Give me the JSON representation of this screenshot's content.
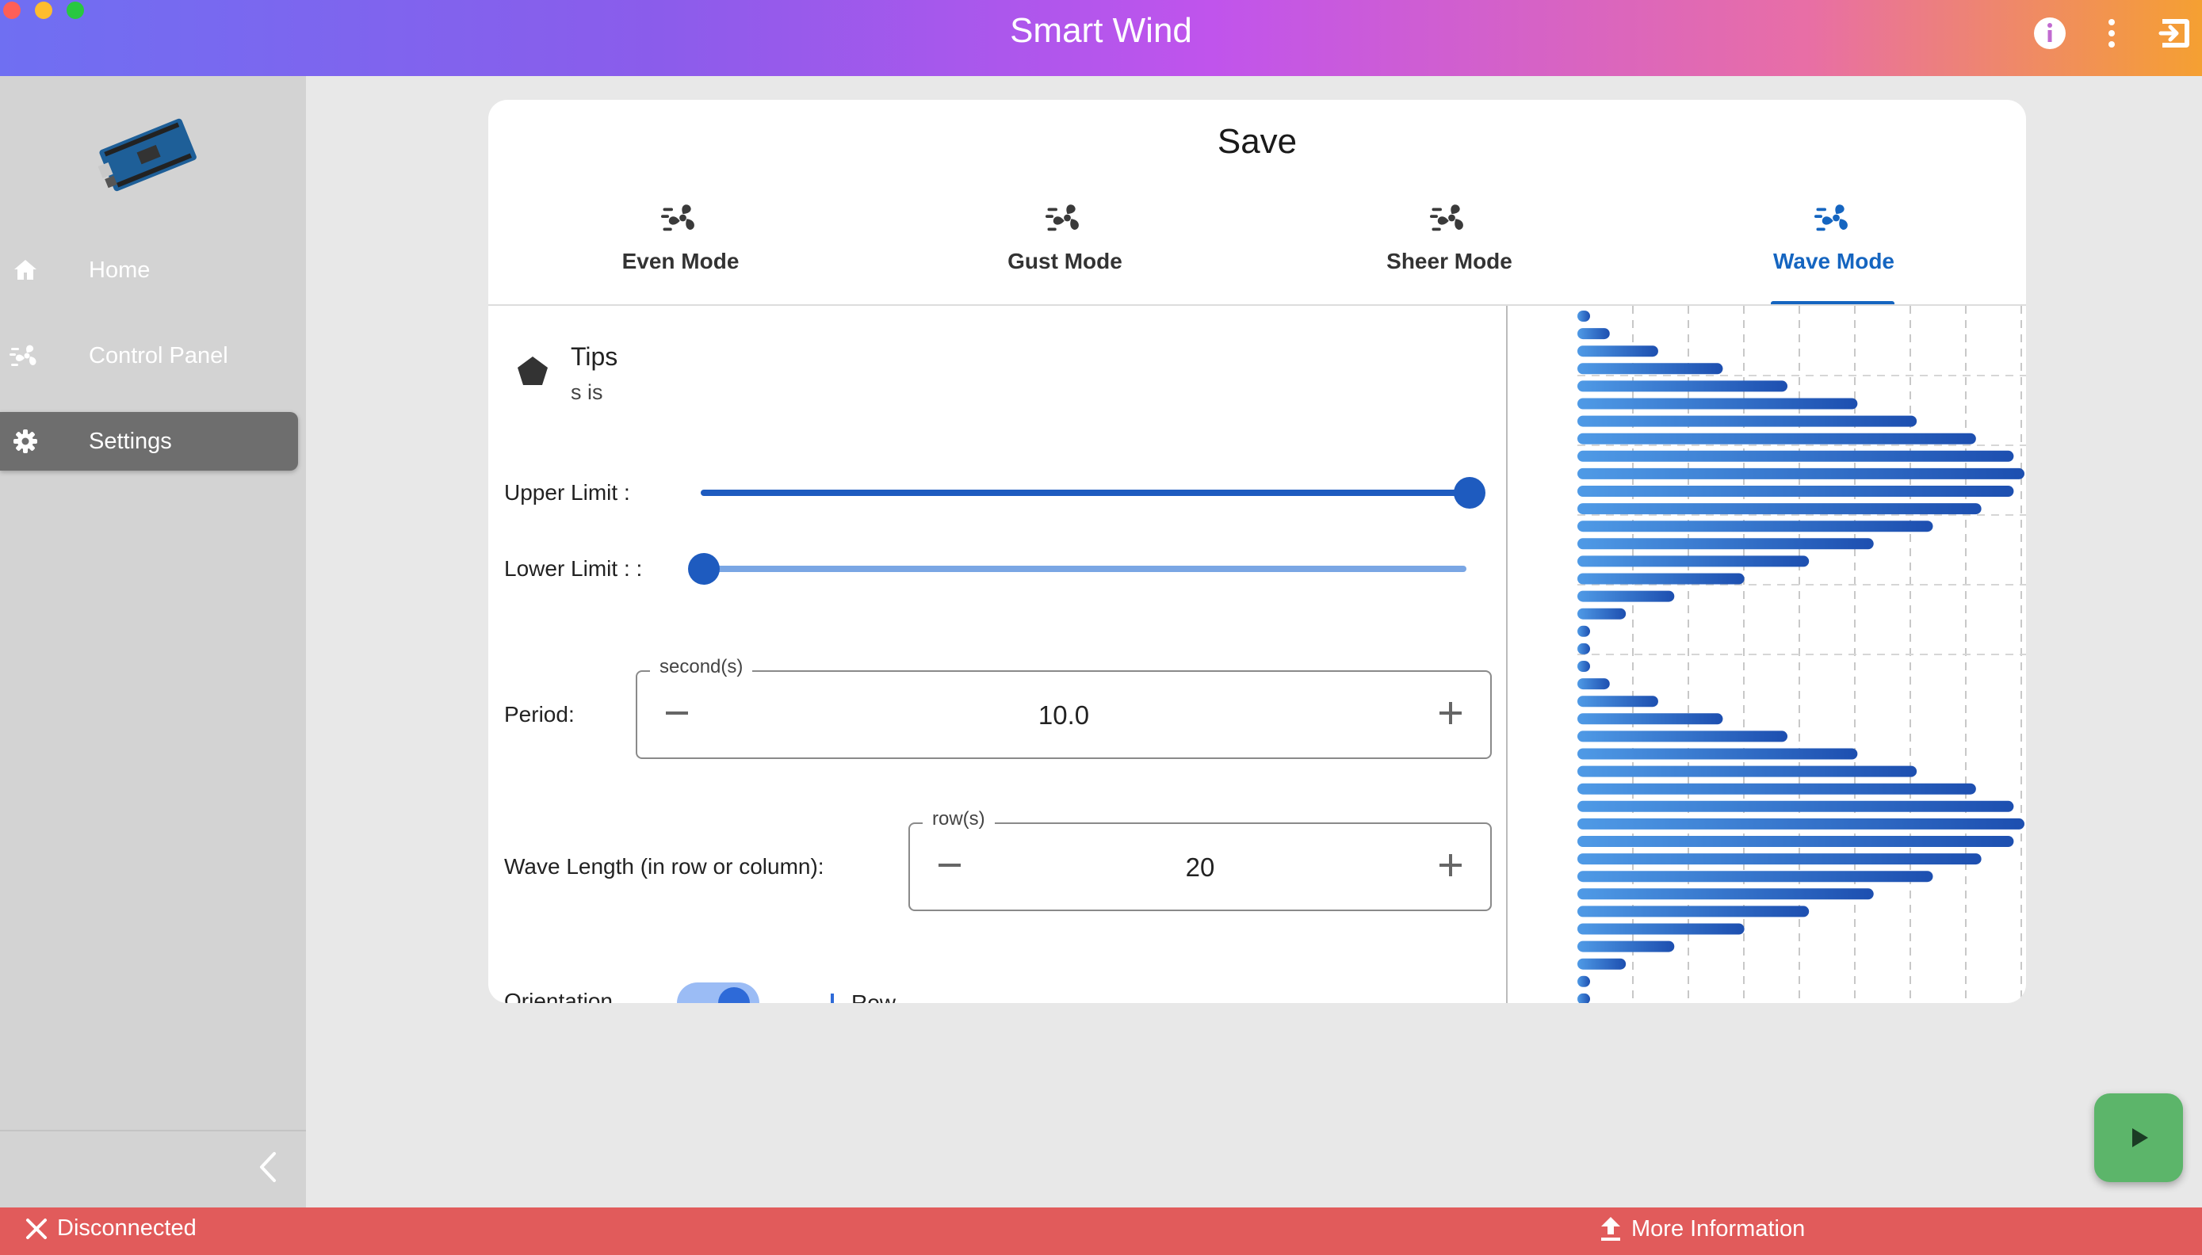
{
  "app": {
    "title": "Smart Wind"
  },
  "titlebar": {
    "icons": [
      "info-icon",
      "more-vert-icon",
      "exit-icon"
    ]
  },
  "sidebar": {
    "items": [
      {
        "label": "Home",
        "icon": "home-icon"
      },
      {
        "label": "Control Panel",
        "icon": "fan-icon"
      },
      {
        "label": "Settings",
        "icon": "gear-icon",
        "active": true
      }
    ]
  },
  "card": {
    "title": "Save",
    "tabs": [
      {
        "label": "Even Mode",
        "icon": "fan-icon"
      },
      {
        "label": "Gust Mode",
        "icon": "fan-icon"
      },
      {
        "label": "Sheer Mode",
        "icon": "fan-icon"
      },
      {
        "label": "Wave Mode",
        "icon": "fan-icon",
        "active": true
      }
    ],
    "tips": {
      "title": "Tips",
      "body": "s is"
    },
    "upper_limit": {
      "label": "Upper Limit :",
      "value": 1.0
    },
    "lower_limit": {
      "label": "Lower Limit :  :",
      "value": 0.0
    },
    "period": {
      "label": "Period:",
      "unit": "second(s)",
      "value": "10.0"
    },
    "wave_length": {
      "label": "Wave Length (in row or column):",
      "unit": "row(s)",
      "value": "20"
    },
    "orientation": {
      "label": "Orientation",
      "option": "Row"
    }
  },
  "chart_data": {
    "type": "bar",
    "orientation": "horizontal",
    "values": [
      0,
      6,
      15,
      27,
      39,
      52,
      63,
      74,
      81,
      83,
      81,
      75,
      66,
      55,
      43,
      31,
      18,
      9,
      1,
      0,
      1,
      6,
      15,
      27,
      39,
      52,
      63,
      74,
      81,
      83,
      81,
      75,
      66,
      55,
      43,
      31,
      18,
      9,
      1,
      0
    ],
    "xlim": [
      0,
      83
    ],
    "grid": true,
    "colors": {
      "bar_start": "#4f9ae6",
      "bar_end": "#1d4fb0"
    }
  },
  "fab": {
    "icon": "play-icon"
  },
  "statusbar": {
    "status": "Disconnected",
    "status_icon": "close-icon",
    "more": "More Information",
    "more_icon": "upload-icon"
  }
}
